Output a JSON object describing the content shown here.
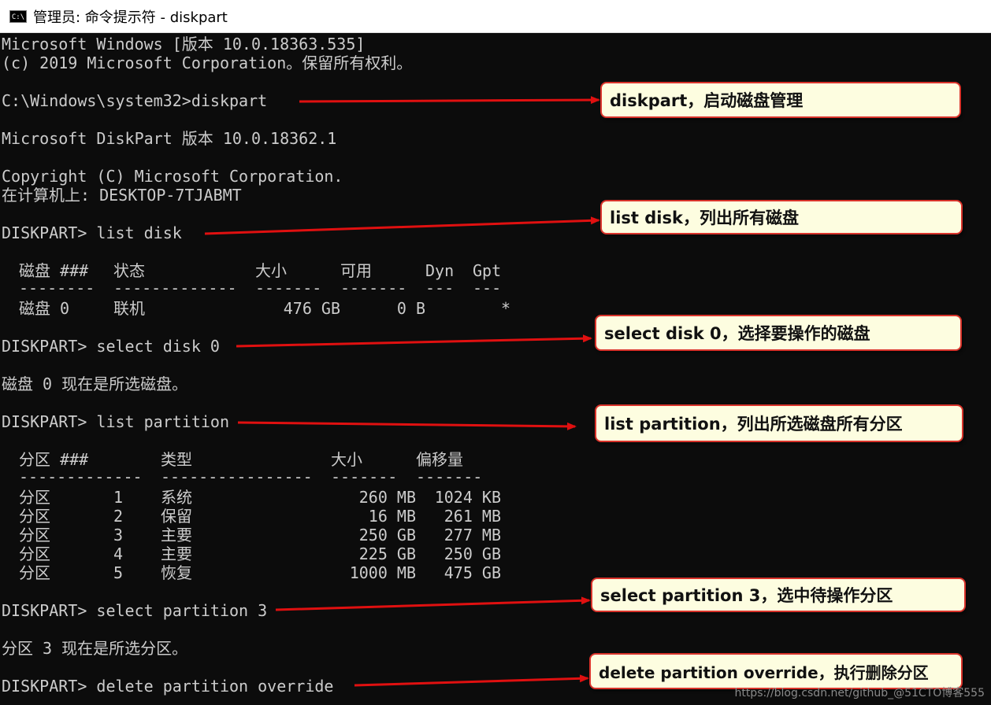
{
  "window": {
    "icon_label": "C:\\",
    "title": "管理员: 命令提示符 - diskpart"
  },
  "console": {
    "lines": [
      "Microsoft Windows [版本 10.0.18363.535]",
      "(c) 2019 Microsoft Corporation。保留所有权利。",
      "C:\\Windows\\system32>diskpart",
      "Microsoft DiskPart 版本 10.0.18362.1",
      "Copyright (C) Microsoft Corporation.",
      "在计算机上: DESKTOP-7TJABMT",
      "DISKPART> list disk",
      "DISKPART> select disk 0",
      "磁盘 0 现在是所选磁盘。",
      "DISKPART> list partition",
      "DISKPART> select partition 3",
      "分区 3 现在是所选分区。",
      "DISKPART> delete partition override"
    ],
    "disk_table": {
      "headers": [
        "磁盘 ###",
        "状态",
        "大小",
        "可用",
        "Dyn",
        "Gpt"
      ],
      "separators": [
        "--------",
        "-------------",
        "-------",
        "-------",
        "---",
        "---"
      ],
      "rows": [
        [
          "磁盘 0",
          "联机",
          "476 GB",
          "0 B",
          "",
          "*"
        ]
      ]
    },
    "partition_table": {
      "headers": [
        "分区 ###",
        "类型",
        "大小",
        "偏移量"
      ],
      "separators": [
        "-------------",
        "----------------",
        "-------",
        "-------"
      ],
      "rows": [
        [
          "分区",
          "1",
          "系统",
          "260 MB",
          "1024 KB"
        ],
        [
          "分区",
          "2",
          "保留",
          "16 MB",
          "261 MB"
        ],
        [
          "分区",
          "3",
          "主要",
          "250 GB",
          "277 MB"
        ],
        [
          "分区",
          "4",
          "主要",
          "225 GB",
          "250 GB"
        ],
        [
          "分区",
          "5",
          "恢复",
          "1000 MB",
          "475 GB"
        ]
      ]
    }
  },
  "callouts": [
    "diskpart，启动磁盘管理",
    "list disk，列出所有磁盘",
    "select disk 0，选择要操作的磁盘",
    "list partition，列出所选磁盘所有分区",
    "select partition 3，选中待操作分区",
    "delete  partition override，执行删除分区"
  ],
  "watermark": "https://blog.csdn.net/github_@51CTO博客555",
  "colors": {
    "terminal_bg": "#0c0c0c",
    "terminal_text": "#cccccc",
    "callout_bg": "#fdfde0",
    "callout_border": "#d9332b",
    "arrow": "#e01010"
  }
}
